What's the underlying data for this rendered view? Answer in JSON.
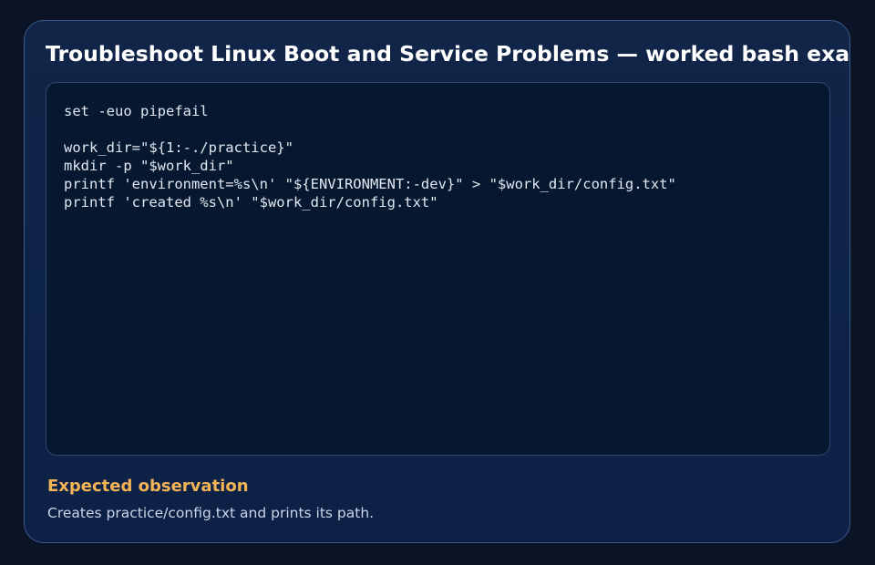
{
  "title": "Troubleshoot Linux Boot and Service Problems — worked bash example",
  "code": {
    "language": "bash",
    "lines": [
      "set -euo pipefail",
      "",
      "work_dir=\"${1:-./practice}\"",
      "mkdir -p \"$work_dir\"",
      "printf 'environment=%s\\n' \"${ENVIRONMENT:-dev}\" > \"$work_dir/config.txt\"",
      "printf 'created %s\\n' \"$work_dir/config.txt\""
    ]
  },
  "observation": {
    "heading": "Expected observation",
    "text": "Creates practice/config.txt and prints its path."
  },
  "colors": {
    "background": "#0b1427",
    "card": "#0f2449",
    "code_panel": "#05182f",
    "heading_accent": "#f3b457"
  }
}
